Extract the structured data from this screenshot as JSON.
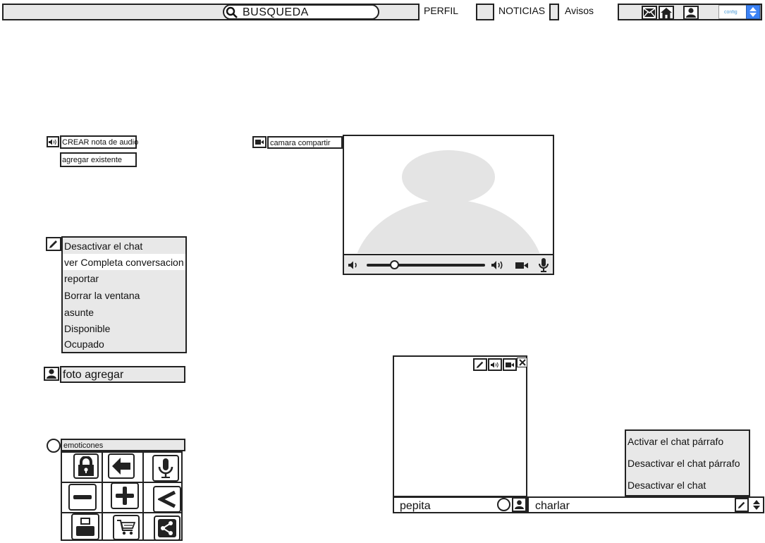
{
  "topbar": {
    "search_label": "BUSQUEDA",
    "nav": [
      {
        "label": "PERFIL"
      },
      {
        "label": "NOTICIAS"
      },
      {
        "label": "Avisos"
      }
    ],
    "icons": [
      "mail-icon",
      "home-icon",
      "user-icon"
    ],
    "config_label": "config"
  },
  "audio_note": {
    "create_label": "CREAR nota de audio",
    "existing_label": "agregar existente"
  },
  "chat_menu": {
    "items": [
      {
        "label": "Desactivar el chat"
      },
      {
        "label": "ver Completa conversacion"
      },
      {
        "label": "reportar"
      },
      {
        "label": "Borrar la ventana"
      },
      {
        "label": "asunte"
      },
      {
        "label": "Disponible"
      },
      {
        "label": "Ocupado"
      }
    ]
  },
  "photo": {
    "label": "foto agregar"
  },
  "emoticons": {
    "label": "emoticones",
    "icons": [
      "lock-icon",
      "arrow-left-icon",
      "microphone-icon",
      "minus-icon",
      "plus-icon",
      "less-than-icon",
      "printer-icon",
      "cart-icon",
      "share-icon"
    ]
  },
  "camera": {
    "share_label": "camara compartir"
  },
  "chat_window": {
    "name": "pepita",
    "message_placeholder": "charlar"
  },
  "chat_options": {
    "items": [
      {
        "label": "Activar el chat párrafo"
      },
      {
        "label": "Desactivar el chat párrafo"
      },
      {
        "label": "Desactivar el chat"
      }
    ]
  },
  "colors": {
    "panel": "#e8e8e8",
    "border": "#222222",
    "accent": "#3b82f6",
    "video_silhouette": "#e4e4e4"
  }
}
